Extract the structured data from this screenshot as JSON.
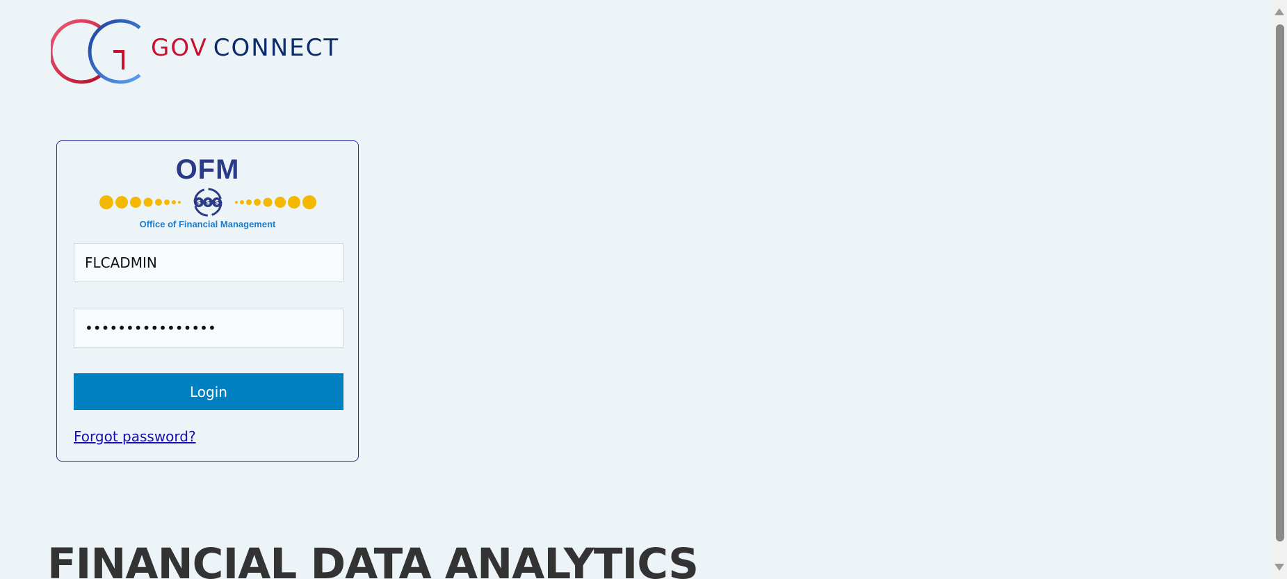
{
  "header": {
    "logo_word_1": "GOV",
    "logo_word_2": "CONNECT"
  },
  "login_card": {
    "brand_title": "OFM",
    "brand_subtitle": "Office of Financial Management",
    "username_value": "FLCADMIN",
    "password_value": "••••••••••••••••",
    "login_label": "Login",
    "forgot_label": "Forgot password?"
  },
  "main": {
    "heading": "FINANCIAL DATA ANALYTICS"
  },
  "colors": {
    "background": "#edf4f8",
    "brand_red": "#c8102e",
    "brand_navy": "#0b2a6b",
    "button_blue": "#0080c0",
    "link": "#1a0dab",
    "card_border": "#2b2f9a",
    "ofm_gold": "#f5b800"
  },
  "icons": {
    "logo": "gov-connect-logo-icon",
    "ofm_emblem": "dollar-gears-icon"
  }
}
